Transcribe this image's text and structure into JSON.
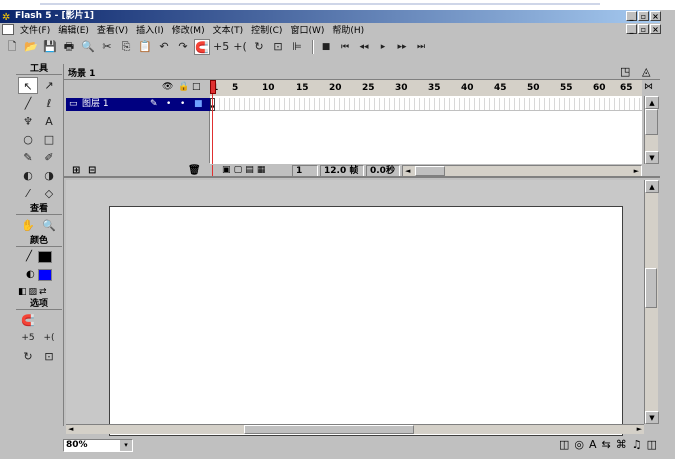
{
  "window": {
    "title": "Flash 5 - [影片1]",
    "caption_min": "_",
    "caption_restore": "▫",
    "caption_close": "×"
  },
  "menu": [
    "文件(F)",
    "编辑(E)",
    "查看(V)",
    "插入(I)",
    "修改(M)",
    "文本(T)",
    "控制(C)",
    "窗口(W)",
    "帮助(H)"
  ],
  "toolbar": {
    "new": "🗋",
    "open": "📂",
    "save": "💾",
    "print": "🖶",
    "preview": "🔍",
    "cut": "✂",
    "copy": "⎘",
    "paste": "📋",
    "undo": "↶",
    "redo": "↷",
    "snap": "🧲",
    "smooth": "+5",
    "straighten": "+(",
    "rotate": "↻",
    "scale": "⊡",
    "align": "⊫",
    "stop": "■",
    "rewind": "⏮",
    "back": "◂◂",
    "play": "▸",
    "forward": "▸▸",
    "end": "⏭"
  },
  "tools_panel": {
    "title": "工具",
    "view_title": "查看",
    "colors_title": "颜色",
    "options_title": "选项",
    "tools": [
      "↖",
      "↗",
      "╱",
      "ℓ",
      "♆",
      "A",
      "○",
      "□",
      "✎",
      "✐",
      "◐",
      "◑",
      "⁄",
      "◇"
    ],
    "view_tools": [
      "✋",
      "🔍"
    ],
    "stroke_icon": "╱",
    "fill_icon": "◐",
    "color_small": [
      "◧",
      "▨",
      "⇄"
    ],
    "options": [
      "🧲",
      "+5",
      "+(",
      "↻",
      "⊡"
    ]
  },
  "scene": {
    "label": "场景 1",
    "edit_symbol_icon": "◳",
    "edit_scene_icon": "◬"
  },
  "timeline": {
    "header_icons": [
      "👁",
      "🔒",
      "□"
    ],
    "layer_name": "图层 1",
    "layer_icons": [
      "✎",
      "•",
      "•",
      "■"
    ],
    "ruler_marks": [
      "1",
      "5",
      "10",
      "15",
      "20",
      "25",
      "30",
      "35",
      "40",
      "45",
      "50",
      "55",
      "60",
      "65"
    ],
    "current_frame": "1",
    "frame_rate": "12.0 帧",
    "elapsed": "0.0秒",
    "add_layer_icon": "⊞",
    "add_guide_icon": "⊟",
    "trash_icon": "🗑",
    "frame_view_icon": "⋈"
  },
  "status": {
    "zoom": "80%",
    "zoom_arrow": "▾",
    "launcher_icons": [
      "◫",
      "◎",
      "A",
      "⇆",
      "⌘",
      "♫",
      "◫"
    ]
  },
  "scroll": {
    "up": "▲",
    "down": "▼",
    "left": "◄",
    "right": "►"
  }
}
